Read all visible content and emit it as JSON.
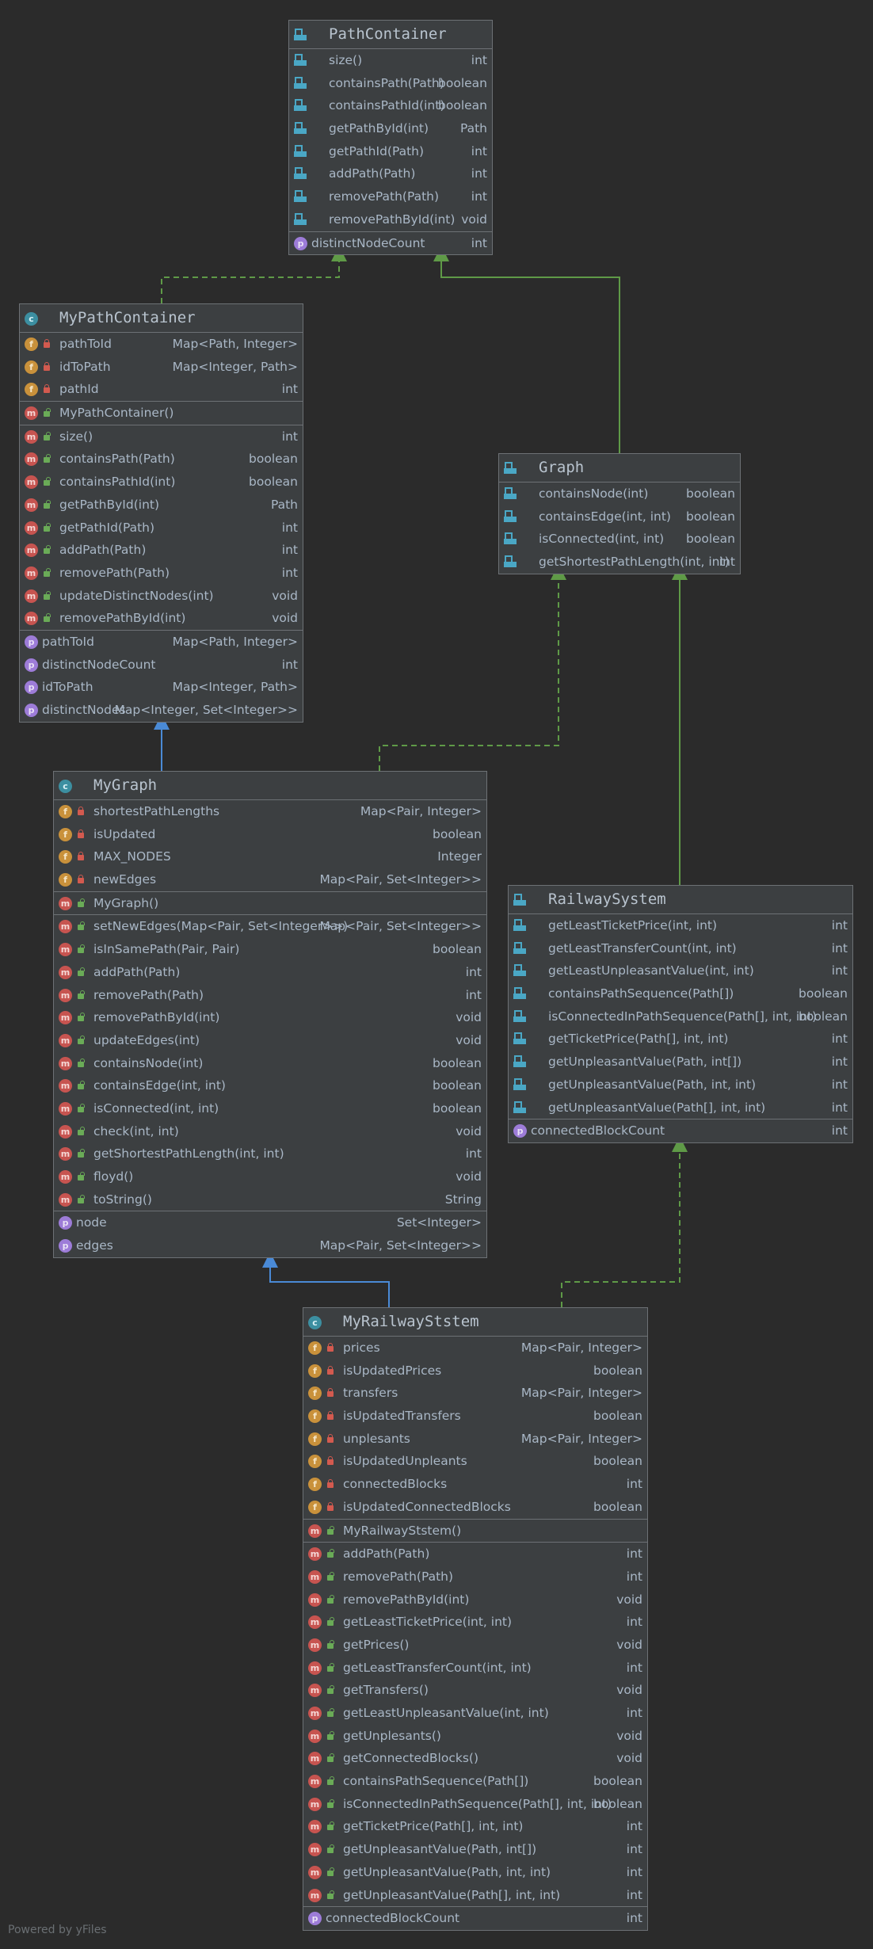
{
  "classes": {
    "pathcontainer": {
      "title": "PathContainer",
      "kind": "interface",
      "sections": [
        [
          {
            "icon": "method-icon",
            "name": "size()",
            "type": "int"
          },
          {
            "icon": "method-icon",
            "name": "containsPath(Path)",
            "type": "boolean"
          },
          {
            "icon": "method-icon",
            "name": "containsPathId(int)",
            "type": "boolean"
          },
          {
            "icon": "method-icon",
            "name": "getPathById(int)",
            "type": "Path"
          },
          {
            "icon": "method-icon",
            "name": "getPathId(Path)",
            "type": "int"
          },
          {
            "icon": "method-icon",
            "name": "addPath(Path)",
            "type": "int"
          },
          {
            "icon": "method-icon",
            "name": "removePath(Path)",
            "type": "int"
          },
          {
            "icon": "method-icon",
            "name": "removePathById(int)",
            "type": "void"
          }
        ],
        [
          {
            "icon": "property-icon",
            "name": "distinctNodeCount",
            "type": "int"
          }
        ]
      ]
    },
    "mypathcontainer": {
      "title": "MyPathContainer",
      "kind": "class",
      "sections": [
        [
          {
            "icon": "field-icon",
            "name": "pathToId",
            "type": "Map<Path, Integer>"
          },
          {
            "icon": "field-icon",
            "name": "idToPath",
            "type": "Map<Integer, Path>"
          },
          {
            "icon": "field-icon",
            "name": "pathId",
            "type": "int"
          }
        ],
        [
          {
            "icon": "constructor-icon",
            "name": "MyPathContainer()",
            "type": ""
          }
        ],
        [
          {
            "icon": "method-icon",
            "name": "size()",
            "type": "int"
          },
          {
            "icon": "method-icon",
            "name": "containsPath(Path)",
            "type": "boolean"
          },
          {
            "icon": "method-icon",
            "name": "containsPathId(int)",
            "type": "boolean"
          },
          {
            "icon": "method-icon",
            "name": "getPathById(int)",
            "type": "Path"
          },
          {
            "icon": "method-icon",
            "name": "getPathId(Path)",
            "type": "int"
          },
          {
            "icon": "method-icon",
            "name": "addPath(Path)",
            "type": "int"
          },
          {
            "icon": "method-icon",
            "name": "removePath(Path)",
            "type": "int"
          },
          {
            "icon": "method-icon",
            "name": "updateDistinctNodes(int)",
            "type": "void"
          },
          {
            "icon": "method-icon",
            "name": "removePathById(int)",
            "type": "void"
          }
        ],
        [
          {
            "icon": "property-icon",
            "name": "pathToId",
            "type": "Map<Path, Integer>"
          },
          {
            "icon": "property-icon",
            "name": "distinctNodeCount",
            "type": "int"
          },
          {
            "icon": "property-icon",
            "name": "idToPath",
            "type": "Map<Integer, Path>"
          },
          {
            "icon": "property-icon",
            "name": "distinctNodes",
            "type": "Map<Integer, Set<Integer>>"
          }
        ]
      ]
    },
    "graph": {
      "title": "Graph",
      "kind": "interface",
      "sections": [
        [
          {
            "icon": "method-icon",
            "name": "containsNode(int)",
            "type": "boolean"
          },
          {
            "icon": "method-icon",
            "name": "containsEdge(int, int)",
            "type": "boolean"
          },
          {
            "icon": "method-icon",
            "name": "isConnected(int, int)",
            "type": "boolean"
          },
          {
            "icon": "method-icon",
            "name": "getShortestPathLength(int, int)",
            "type": "int"
          }
        ]
      ]
    },
    "mygraph": {
      "title": "MyGraph",
      "kind": "class",
      "sections": [
        [
          {
            "icon": "field-icon",
            "name": "shortestPathLengths",
            "type": "Map<Pair, Integer>"
          },
          {
            "icon": "field-icon",
            "name": "isUpdated",
            "type": "boolean"
          },
          {
            "icon": "field-icon",
            "name": "MAX_NODES",
            "type": "Integer"
          },
          {
            "icon": "field-icon",
            "name": "newEdges",
            "type": "Map<Pair, Set<Integer>>"
          }
        ],
        [
          {
            "icon": "constructor-icon",
            "name": "MyGraph()",
            "type": ""
          }
        ],
        [
          {
            "icon": "method-icon",
            "name": "setNewEdges(Map<Pair, Set<Integer>>)",
            "type": "Map<Pair, Set<Integer>>"
          },
          {
            "icon": "method-icon",
            "name": "isInSamePath(Pair, Pair)",
            "type": "boolean"
          },
          {
            "icon": "method-icon",
            "name": "addPath(Path)",
            "type": "int"
          },
          {
            "icon": "method-icon",
            "name": "removePath(Path)",
            "type": "int"
          },
          {
            "icon": "method-icon",
            "name": "removePathById(int)",
            "type": "void"
          },
          {
            "icon": "method-icon",
            "name": "updateEdges(int)",
            "type": "void"
          },
          {
            "icon": "method-icon",
            "name": "containsNode(int)",
            "type": "boolean"
          },
          {
            "icon": "method-icon",
            "name": "containsEdge(int, int)",
            "type": "boolean"
          },
          {
            "icon": "method-icon",
            "name": "isConnected(int, int)",
            "type": "boolean"
          },
          {
            "icon": "method-icon",
            "name": "check(int, int)",
            "type": "void"
          },
          {
            "icon": "method-icon",
            "name": "getShortestPathLength(int, int)",
            "type": "int"
          },
          {
            "icon": "method-icon",
            "name": "floyd()",
            "type": "void"
          },
          {
            "icon": "method-icon",
            "name": "toString()",
            "type": "String"
          }
        ],
        [
          {
            "icon": "property-icon",
            "name": "node",
            "type": "Set<Integer>"
          },
          {
            "icon": "property-icon",
            "name": "edges",
            "type": "Map<Pair, Set<Integer>>"
          }
        ]
      ]
    },
    "railwaysystem": {
      "title": "RailwaySystem",
      "kind": "interface",
      "sections": [
        [
          {
            "icon": "method-icon",
            "name": "getLeastTicketPrice(int, int)",
            "type": "int"
          },
          {
            "icon": "method-icon",
            "name": "getLeastTransferCount(int, int)",
            "type": "int"
          },
          {
            "icon": "method-icon",
            "name": "getLeastUnpleasantValue(int, int)",
            "type": "int"
          },
          {
            "icon": "method-icon",
            "name": "containsPathSequence(Path[])",
            "type": "boolean"
          },
          {
            "icon": "method-icon",
            "name": "isConnectedInPathSequence(Path[], int, int)",
            "type": "boolean"
          },
          {
            "icon": "method-icon",
            "name": "getTicketPrice(Path[], int, int)",
            "type": "int"
          },
          {
            "icon": "method-icon",
            "name": "getUnpleasantValue(Path, int[])",
            "type": "int"
          },
          {
            "icon": "method-icon",
            "name": "getUnpleasantValue(Path, int, int)",
            "type": "int"
          },
          {
            "icon": "method-icon",
            "name": "getUnpleasantValue(Path[], int, int)",
            "type": "int"
          }
        ],
        [
          {
            "icon": "property-icon",
            "name": "connectedBlockCount",
            "type": "int"
          }
        ]
      ]
    },
    "myrailwaystem": {
      "title": "MyRailwayStstem",
      "kind": "class",
      "sections": [
        [
          {
            "icon": "field-icon",
            "name": "prices",
            "type": "Map<Pair, Integer>"
          },
          {
            "icon": "field-icon",
            "name": "isUpdatedPrices",
            "type": "boolean"
          },
          {
            "icon": "field-icon",
            "name": "transfers",
            "type": "Map<Pair, Integer>"
          },
          {
            "icon": "field-icon",
            "name": "isUpdatedTransfers",
            "type": "boolean"
          },
          {
            "icon": "field-icon",
            "name": "unplesants",
            "type": "Map<Pair, Integer>"
          },
          {
            "icon": "field-icon",
            "name": "isUpdatedUnpleants",
            "type": "boolean"
          },
          {
            "icon": "field-icon",
            "name": "connectedBlocks",
            "type": "int"
          },
          {
            "icon": "field-icon",
            "name": "isUpdatedConnectedBlocks",
            "type": "boolean"
          }
        ],
        [
          {
            "icon": "constructor-icon",
            "name": "MyRailwayStstem()",
            "type": ""
          }
        ],
        [
          {
            "icon": "method-icon",
            "name": "addPath(Path)",
            "type": "int"
          },
          {
            "icon": "method-icon",
            "name": "removePath(Path)",
            "type": "int"
          },
          {
            "icon": "method-icon",
            "name": "removePathById(int)",
            "type": "void"
          },
          {
            "icon": "method-icon",
            "name": "getLeastTicketPrice(int, int)",
            "type": "int"
          },
          {
            "icon": "method-icon",
            "name": "getPrices()",
            "type": "void"
          },
          {
            "icon": "method-icon",
            "name": "getLeastTransferCount(int, int)",
            "type": "int"
          },
          {
            "icon": "method-icon",
            "name": "getTransfers()",
            "type": "void"
          },
          {
            "icon": "method-icon",
            "name": "getLeastUnpleasantValue(int, int)",
            "type": "int"
          },
          {
            "icon": "method-icon",
            "name": "getUnplesants()",
            "type": "void"
          },
          {
            "icon": "method-icon",
            "name": "getConnectedBlocks()",
            "type": "void"
          },
          {
            "icon": "method-icon",
            "name": "containsPathSequence(Path[])",
            "type": "boolean"
          },
          {
            "icon": "method-icon",
            "name": "isConnectedInPathSequence(Path[], int, int)",
            "type": "boolean"
          },
          {
            "icon": "method-icon",
            "name": "getTicketPrice(Path[], int, int)",
            "type": "int"
          },
          {
            "icon": "method-icon",
            "name": "getUnpleasantValue(Path, int[])",
            "type": "int"
          },
          {
            "icon": "method-icon",
            "name": "getUnpleasantValue(Path, int, int)",
            "type": "int"
          },
          {
            "icon": "method-icon",
            "name": "getUnpleasantValue(Path[], int, int)",
            "type": "int"
          }
        ],
        [
          {
            "icon": "property-icon",
            "name": "connectedBlockCount",
            "type": "int"
          }
        ]
      ]
    }
  },
  "relations": [
    {
      "from": "MyPathContainer",
      "to": "PathContainer",
      "kind": "implements"
    },
    {
      "from": "Graph",
      "to": "PathContainer",
      "kind": "extends"
    },
    {
      "from": "MyGraph",
      "to": "MyPathContainer",
      "kind": "extends"
    },
    {
      "from": "MyGraph",
      "to": "Graph",
      "kind": "implements"
    },
    {
      "from": "RailwaySystem",
      "to": "Graph",
      "kind": "extends"
    },
    {
      "from": "MyRailwayStstem",
      "to": "MyGraph",
      "kind": "extends"
    },
    {
      "from": "MyRailwayStstem",
      "to": "RailwaySystem",
      "kind": "implements"
    }
  ],
  "colors": {
    "background": "#2b2b2b",
    "box": "#3c3f41",
    "border": "#6d7175",
    "text": "#a9b7c6",
    "implements_edge": "#5f9a47",
    "extends_interface_edge": "#5f9a47",
    "extends_class_edge": "#4a8ad6"
  },
  "footer": {
    "watermark": "Powered by yFiles"
  }
}
